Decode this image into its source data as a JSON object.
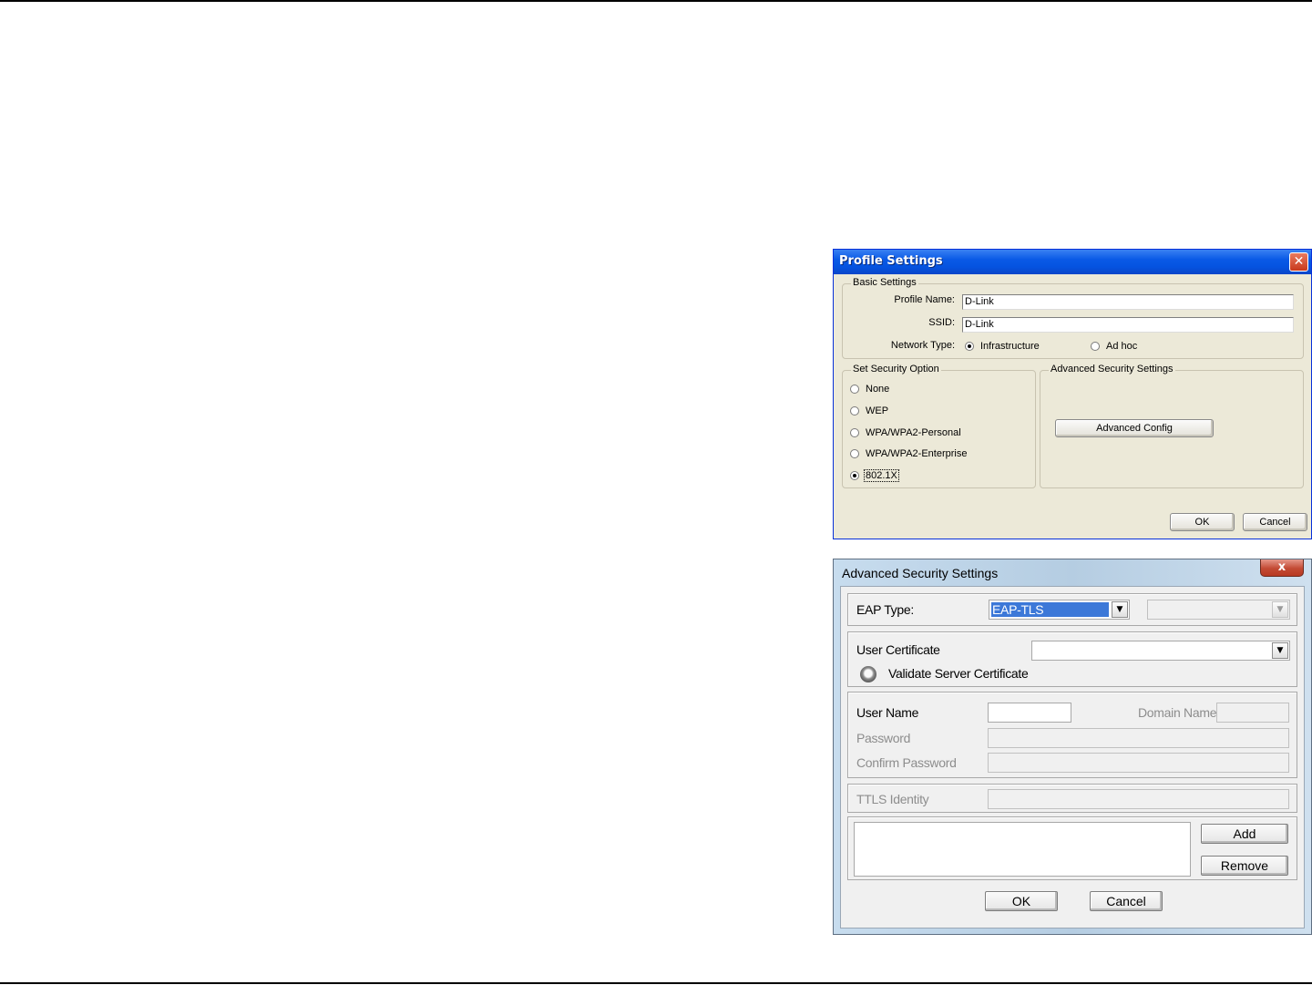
{
  "profile_dialog": {
    "title": "Profile Settings",
    "close_symbol": "✕",
    "basic_settings": {
      "legend": "Basic Settings",
      "profile_name_label": "Profile Name:",
      "profile_name_value": "D-Link",
      "ssid_label": "SSID:",
      "ssid_value": "D-Link",
      "network_type_label": "Network Type:",
      "network_types": [
        "Infrastructure",
        "Ad hoc"
      ],
      "network_type_selected": "Infrastructure"
    },
    "security_option": {
      "legend": "Set Security Option",
      "options": [
        "None",
        "WEP",
        "WPA/WPA2-Personal",
        "WPA/WPA2-Enterprise",
        "802.1X"
      ],
      "selected": "802.1X"
    },
    "advanced_security": {
      "legend": "Advanced Security Settings",
      "button_label": "Advanced Config"
    },
    "ok_label": "OK",
    "cancel_label": "Cancel",
    "title_bar_color": "#0a5ae6"
  },
  "advanced_dialog": {
    "title": "Advanced Security Settings",
    "close_symbol": "x",
    "eap_type_label": "EAP Type:",
    "eap_type_value": "EAP-TLS",
    "user_certificate_label": "User Certificate",
    "user_certificate_value": "",
    "validate_server_certificate_label": "Validate Server Certificate",
    "user_name_label": "User Name",
    "user_name_value": "",
    "domain_name_label": "Domain Name",
    "password_label": "Password",
    "confirm_password_label": "Confirm Password",
    "ttls_identity_label": "TTLS Identity",
    "add_label": "Add",
    "remove_label": "Remove",
    "ok_label": "OK",
    "cancel_label": "Cancel",
    "selection_color": "#3c78d8",
    "disabled_text_color": "#8d8d8d"
  }
}
